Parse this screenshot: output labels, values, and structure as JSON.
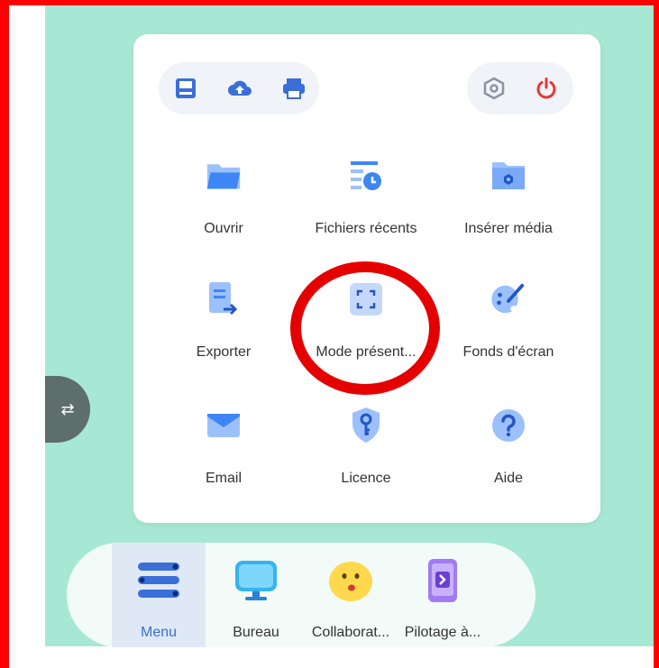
{
  "top_bar": {
    "left_buttons": [
      "save-icon",
      "upload-cloud-icon",
      "print-icon"
    ],
    "right_buttons": [
      "settings-hexagon-icon",
      "power-icon"
    ]
  },
  "menu_items": [
    {
      "label": "Ouvrir",
      "icon": "folder-icon"
    },
    {
      "label": "Fichiers récents",
      "icon": "recent-files-icon"
    },
    {
      "label": "Insérer média",
      "icon": "media-folder-icon"
    },
    {
      "label": "Exporter",
      "icon": "export-icon"
    },
    {
      "label": "Mode présent...",
      "icon": "fullscreen-icon"
    },
    {
      "label": "Fonds d'écran",
      "icon": "palette-icon"
    },
    {
      "label": "Email",
      "icon": "envelope-icon"
    },
    {
      "label": "Licence",
      "icon": "key-shield-icon"
    },
    {
      "label": "Aide",
      "icon": "help-icon"
    }
  ],
  "dock": [
    {
      "label": "Menu",
      "icon": "menu-icon",
      "active": true
    },
    {
      "label": "Bureau",
      "icon": "monitor-icon",
      "active": false
    },
    {
      "label": "Collaborat...",
      "icon": "emoji-icon",
      "active": false
    },
    {
      "label": "Pilotage à...",
      "icon": "phone-remote-icon",
      "active": false
    }
  ],
  "side_handle": {
    "glyph": "⇄",
    "icon": "swap-icon"
  },
  "colors": {
    "desktop": "#a6e8d3",
    "accent_blue": "#3b6fd8",
    "icon_blue": "#4c8ef7",
    "power_red": "#e53935",
    "annotation_red": "#e50000"
  }
}
